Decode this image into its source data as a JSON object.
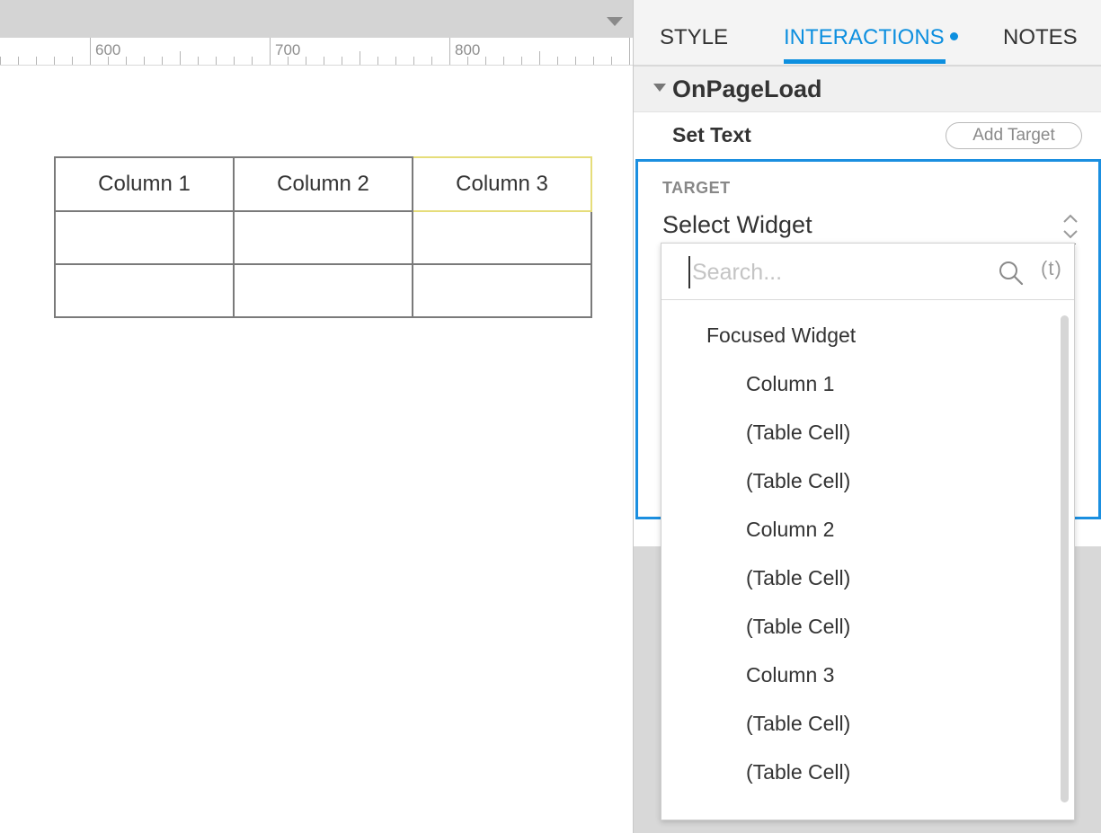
{
  "ruler": {
    "labels": [
      "600",
      "700",
      "800"
    ]
  },
  "table": {
    "headers": [
      "Column 1",
      "Column 2",
      "Column 3"
    ],
    "rows": [
      [
        "",
        "",
        ""
      ],
      [
        "",
        "",
        ""
      ]
    ]
  },
  "tabs": {
    "style": "STYLE",
    "interactions": "INTERACTIONS",
    "notes": "NOTES"
  },
  "event": {
    "title": "OnPageLoad"
  },
  "action": {
    "title": "Set Text",
    "add_target": "Add Target"
  },
  "target": {
    "label": "TARGET",
    "value": "Select Widget"
  },
  "dropdown": {
    "search_placeholder": "Search...",
    "variable_glyph": "(t)",
    "items": [
      "Focused Widget",
      "Column 1",
      "(Table Cell)",
      "(Table Cell)",
      "Column 2",
      "(Table Cell)",
      "(Table Cell)",
      "Column 3",
      "(Table Cell)",
      "(Table Cell)"
    ]
  },
  "colors": {
    "accent": "#0d8fdf",
    "selection": "#e6dd7a"
  }
}
